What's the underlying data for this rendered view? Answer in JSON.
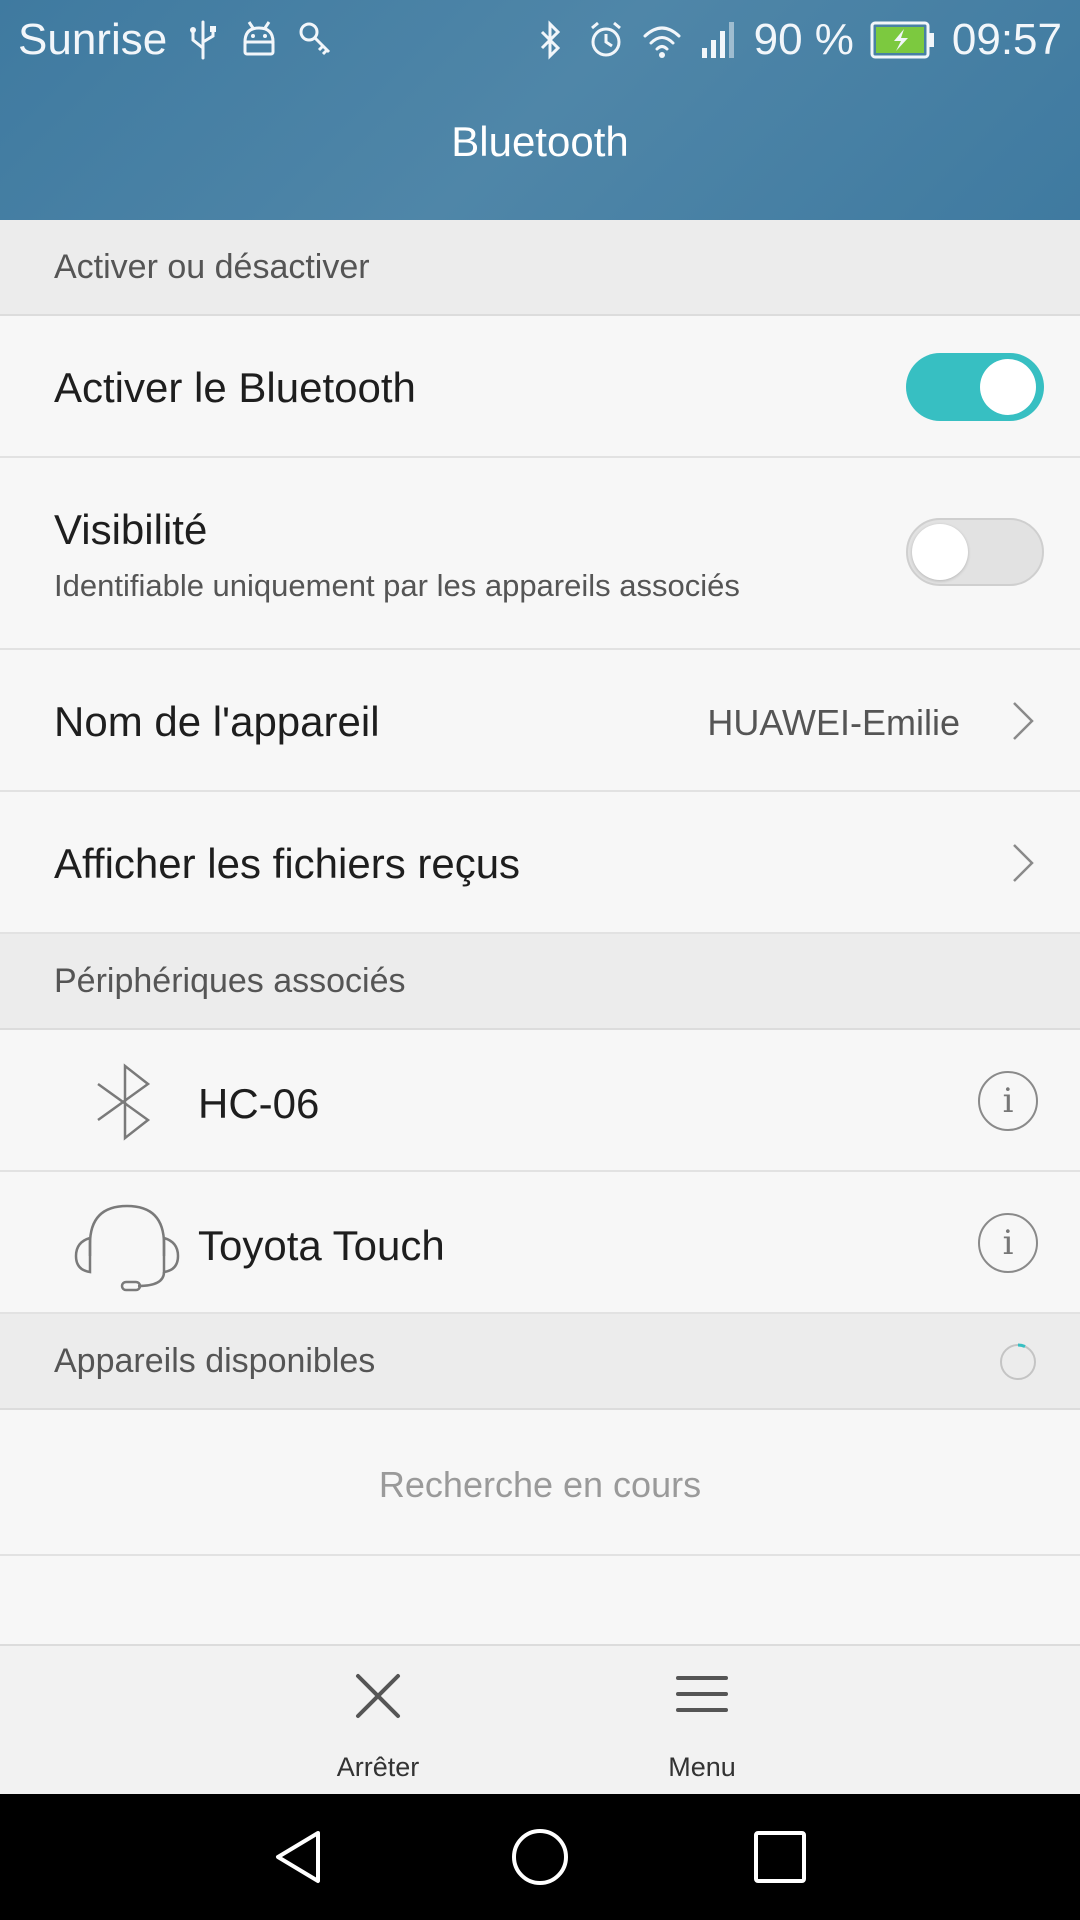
{
  "status_bar": {
    "carrier": "Sunrise",
    "battery_percent": "90 %",
    "time": "09:57",
    "left_icons": [
      "usb-icon",
      "android-debug-icon",
      "key-icon"
    ],
    "right_icons": [
      "bluetooth-icon",
      "alarm-icon",
      "wifi-icon",
      "signal-icon",
      "battery-charging-icon"
    ]
  },
  "header": {
    "title": "Bluetooth"
  },
  "section_toggle": {
    "label": "Activer ou désactiver"
  },
  "bluetooth_toggle": {
    "label": "Activer le Bluetooth",
    "enabled": true
  },
  "visibility": {
    "label": "Visibilité",
    "description": "Identifiable uniquement par les appareils associés",
    "enabled": false
  },
  "device_name": {
    "label": "Nom de l'appareil",
    "value": "HUAWEI-Emilie"
  },
  "received_files": {
    "label": "Afficher les fichiers reçus"
  },
  "section_paired": {
    "label": "Périphériques associés"
  },
  "paired_devices": [
    {
      "name": "HC-06",
      "icon": "bluetooth-icon"
    },
    {
      "name": "Toyota Touch",
      "icon": "headset-icon"
    }
  ],
  "section_available": {
    "label": "Appareils disponibles"
  },
  "available_status": "Recherche en cours",
  "bottom_bar": {
    "stop_label": "Arrêter",
    "menu_label": "Menu"
  },
  "colors": {
    "accent": "#37bfc2",
    "header_bg": "#4a81a4",
    "navbar_bg": "#000000"
  }
}
